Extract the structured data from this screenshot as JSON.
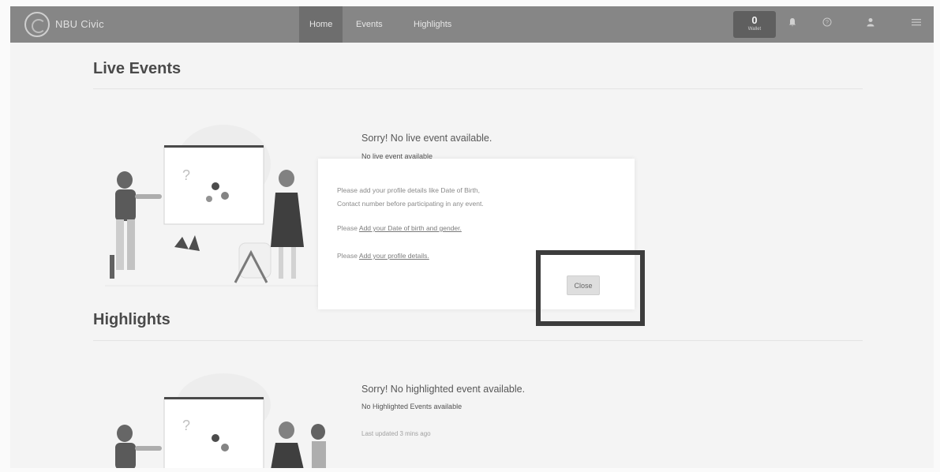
{
  "navbar": {
    "brand": "NBU Civic",
    "tabs": [
      {
        "label": "Home",
        "active": true
      },
      {
        "label": "Events",
        "active": false
      },
      {
        "label": "Highlights",
        "active": false
      }
    ],
    "wallet": {
      "count": "0",
      "label": "Wallet"
    },
    "icons": [
      "bell-icon",
      "help-icon",
      "user-icon",
      "menu-icon"
    ]
  },
  "live": {
    "title": "Live Events",
    "empty_title": "Sorry! No live event available.",
    "empty_sub": "No live event available"
  },
  "highlights": {
    "title": "Highlights",
    "empty_title": "Sorry! No highlighted event available.",
    "empty_sub": "No Highlighted Events available",
    "updated": "Last updated 3 mins ago"
  },
  "modal": {
    "line1": "Please add your profile details like Date of Birth,",
    "line2": "Contact number before participating in any event.",
    "please": "Please",
    "link_dob": "Add your Date of birth and gender.",
    "link_profile": "Add your profile details.",
    "close_label": "Close"
  },
  "colors": {
    "navbar": "#868686",
    "active_tab": "#6e6e6e",
    "highlight_box": "#3c3c3c"
  }
}
